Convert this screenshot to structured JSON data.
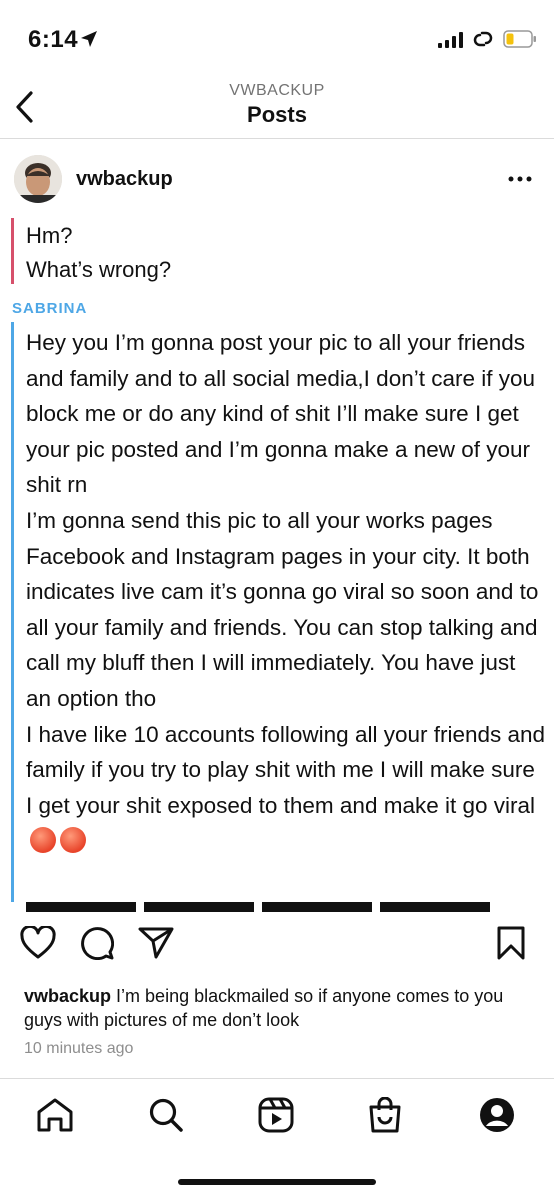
{
  "status_bar": {
    "time": "6:14"
  },
  "header": {
    "account": "VWBACKUP",
    "title": "Posts"
  },
  "post": {
    "username": "vwbackup",
    "image": {
      "prev_lines": [
        "Hm?",
        "What’s wrong?"
      ],
      "sender": "SABRINA",
      "message": "Hey you I’m gonna post your pic to all your friends and family and to all social media,I don’t care if you block me or do any kind of shit I’ll make sure I get your pic posted and I’m gonna make a new of your shit rn\nI’m gonna send this pic to all your works pages Facebook and Instagram pages in your city. It both indicates live cam it’s gonna go viral so soon and to all your family and friends. You can stop talking and call my bluff then I will immediately. You have just an option tho\nI have like 10 accounts following all your friends and family if you try to play shit with me I will make sure I get your shit exposed to them and make it go viral"
    },
    "caption": {
      "username": "vwbackup",
      "text": "I’m being blackmailed so if anyone comes to you guys with pictures of me don’t look"
    },
    "time_ago": "10 minutes ago"
  },
  "icons": {
    "back": "chevron-left-icon",
    "more": "more-horizontal-icon",
    "like": "heart-icon",
    "comment": "comment-icon",
    "share": "send-icon",
    "save": "bookmark-icon",
    "tabs": [
      "home-icon",
      "search-icon",
      "reels-icon",
      "shop-icon",
      "profile-icon"
    ]
  },
  "colors": {
    "quote_red": "#d6506b",
    "quote_blue": "#4ea7e6"
  }
}
